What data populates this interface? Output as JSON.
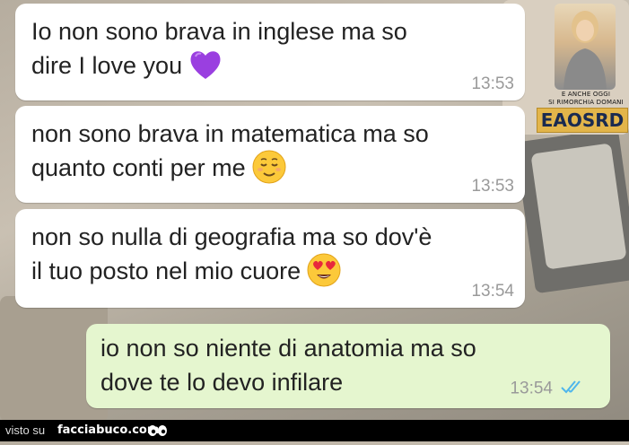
{
  "messages": [
    {
      "text_line1": "Io non sono brava in inglese ma so",
      "text_line2": "dire I love you",
      "emoji": "purple-heart",
      "time": "13:53",
      "direction": "incoming"
    },
    {
      "text_line1": "non sono brava in matematica ma so",
      "text_line2": "quanto conti per me",
      "emoji": "relieved-face",
      "time": "13:53",
      "direction": "incoming"
    },
    {
      "text_line1": "non so nulla di geografia ma so dov'è",
      "text_line2": "il tuo posto nel mio cuore",
      "emoji": "heart-eyes-face",
      "time": "13:54",
      "direction": "incoming"
    },
    {
      "text_line1": "io non so niente di anatomia ma so",
      "text_line2": "dove te lo devo infilare",
      "time": "13:54",
      "direction": "outgoing",
      "status": "read-double-check"
    }
  ],
  "colors": {
    "incoming_bubble": "#ffffff",
    "outgoing_bubble": "#e5f6cf",
    "read_ticks": "#4fb6ec"
  },
  "watermark": {
    "caption1": "E ANCHE OGGI",
    "caption2": "SI RIMORCHIA DOMANI",
    "logo": "EAOSRD"
  },
  "footer": {
    "visto_su": "visto su",
    "site": "facciabuco.com"
  }
}
